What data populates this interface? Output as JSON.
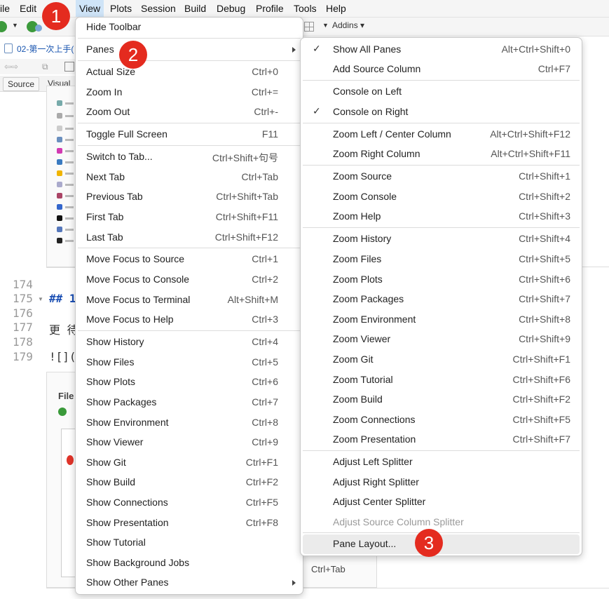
{
  "menubar": {
    "items": [
      "ile",
      "Edit",
      "View",
      "Plots",
      "Session",
      "Build",
      "Debug",
      "Profile",
      "Tools",
      "Help"
    ],
    "active": "View"
  },
  "toolbar": {
    "addins_label": "Addins"
  },
  "editor": {
    "file_tab": "02-第一次上手(",
    "mode_tabs": [
      "Source",
      "Visual"
    ],
    "line_numbers": [
      "174",
      "175",
      "176",
      "177",
      "178",
      "179"
    ],
    "code_lines": [
      "",
      "## 1",
      "",
      "更 待",
      "",
      "![]("
    ],
    "lower_panel_label": "File",
    "stray_shortcut": "Ctrl+Tab"
  },
  "view_menu": {
    "items": [
      {
        "label": "Hide Toolbar",
        "shortcut": ""
      },
      {
        "label": "Panes",
        "shortcut": "",
        "submenu": true
      },
      {
        "label": "Actual Size",
        "shortcut": "Ctrl+0"
      },
      {
        "label": "Zoom In",
        "shortcut": "Ctrl+="
      },
      {
        "label": "Zoom Out",
        "shortcut": "Ctrl+-"
      },
      {
        "label": "Toggle Full Screen",
        "shortcut": "F11"
      },
      {
        "label": "Switch to Tab...",
        "shortcut": "Ctrl+Shift+句号"
      },
      {
        "label": "Next Tab",
        "shortcut": "Ctrl+Tab"
      },
      {
        "label": "Previous Tab",
        "shortcut": "Ctrl+Shift+Tab"
      },
      {
        "label": "First Tab",
        "shortcut": "Ctrl+Shift+F11"
      },
      {
        "label": "Last Tab",
        "shortcut": "Ctrl+Shift+F12"
      },
      {
        "label": "Move Focus to Source",
        "shortcut": "Ctrl+1"
      },
      {
        "label": "Move Focus to Console",
        "shortcut": "Ctrl+2"
      },
      {
        "label": "Move Focus to Terminal",
        "shortcut": "Alt+Shift+M"
      },
      {
        "label": "Move Focus to Help",
        "shortcut": "Ctrl+3"
      },
      {
        "label": "Show History",
        "shortcut": "Ctrl+4"
      },
      {
        "label": "Show Files",
        "shortcut": "Ctrl+5"
      },
      {
        "label": "Show Plots",
        "shortcut": "Ctrl+6"
      },
      {
        "label": "Show Packages",
        "shortcut": "Ctrl+7"
      },
      {
        "label": "Show Environment",
        "shortcut": "Ctrl+8"
      },
      {
        "label": "Show Viewer",
        "shortcut": "Ctrl+9"
      },
      {
        "label": "Show Git",
        "shortcut": "Ctrl+F1"
      },
      {
        "label": "Show Build",
        "shortcut": "Ctrl+F2"
      },
      {
        "label": "Show Connections",
        "shortcut": "Ctrl+F5"
      },
      {
        "label": "Show Presentation",
        "shortcut": "Ctrl+F8"
      },
      {
        "label": "Show Tutorial",
        "shortcut": ""
      },
      {
        "label": "Show Background Jobs",
        "shortcut": ""
      },
      {
        "label": "Show Other Panes",
        "shortcut": "",
        "submenu": true
      }
    ]
  },
  "panes_menu": {
    "items": [
      {
        "label": "Show All Panes",
        "shortcut": "Alt+Ctrl+Shift+0",
        "checked": true
      },
      {
        "label": "Add Source Column",
        "shortcut": "Ctrl+F7"
      },
      {
        "label": "Console on Left",
        "shortcut": ""
      },
      {
        "label": "Console on Right",
        "shortcut": "",
        "checked": true
      },
      {
        "label": "Zoom Left / Center Column",
        "shortcut": "Alt+Ctrl+Shift+F12"
      },
      {
        "label": "Zoom Right Column",
        "shortcut": "Alt+Ctrl+Shift+F11"
      },
      {
        "label": "Zoom Source",
        "shortcut": "Ctrl+Shift+1"
      },
      {
        "label": "Zoom Console",
        "shortcut": "Ctrl+Shift+2"
      },
      {
        "label": "Zoom Help",
        "shortcut": "Ctrl+Shift+3"
      },
      {
        "label": "Zoom History",
        "shortcut": "Ctrl+Shift+4"
      },
      {
        "label": "Zoom Files",
        "shortcut": "Ctrl+Shift+5"
      },
      {
        "label": "Zoom Plots",
        "shortcut": "Ctrl+Shift+6"
      },
      {
        "label": "Zoom Packages",
        "shortcut": "Ctrl+Shift+7"
      },
      {
        "label": "Zoom Environment",
        "shortcut": "Ctrl+Shift+8"
      },
      {
        "label": "Zoom Viewer",
        "shortcut": "Ctrl+Shift+9"
      },
      {
        "label": "Zoom Git",
        "shortcut": "Ctrl+Shift+F1"
      },
      {
        "label": "Zoom Tutorial",
        "shortcut": "Ctrl+Shift+F6"
      },
      {
        "label": "Zoom Build",
        "shortcut": "Ctrl+Shift+F2"
      },
      {
        "label": "Zoom Connections",
        "shortcut": "Ctrl+Shift+F5"
      },
      {
        "label": "Zoom Presentation",
        "shortcut": "Ctrl+Shift+F7"
      },
      {
        "label": "Adjust Left Splitter",
        "shortcut": ""
      },
      {
        "label": "Adjust Right Splitter",
        "shortcut": ""
      },
      {
        "label": "Adjust Center Splitter",
        "shortcut": ""
      },
      {
        "label": "Adjust Source Column Splitter",
        "shortcut": "",
        "disabled": true
      },
      {
        "label": "Pane Layout...",
        "shortcut": "",
        "highlighted": true
      }
    ]
  },
  "badges": [
    "1",
    "2",
    "3"
  ],
  "colors": {
    "badge": "#e42b1f",
    "menu_highlight": "#ebebeb",
    "menubar_active": "#cfe4f7"
  }
}
